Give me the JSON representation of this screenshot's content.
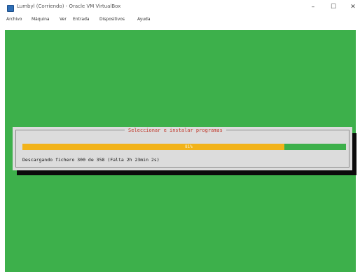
{
  "window": {
    "title": "Lumbyl (Corriendo) - Oracle VM VirtualBox",
    "controls": {
      "minimize": "–",
      "maximize": "☐",
      "close": "✕"
    },
    "icon": "virtualbox-icon"
  },
  "menubar": {
    "items": [
      {
        "label": "Archivo"
      },
      {
        "label": "Máquina"
      },
      {
        "label": "Ver"
      },
      {
        "label": "Entrada"
      },
      {
        "label": "Dispositivos"
      },
      {
        "label": "Ayuda"
      }
    ]
  },
  "installer": {
    "dialog_title": "Seleccionar e instalar programas",
    "progress_percent": 81,
    "progress_label": "81%",
    "status_text": "Descargando fichero 300 de 358 (Falta 2h 23min 2s)",
    "colors": {
      "background": "#3db04b",
      "progress": "#f2b31a",
      "dialog": "#dcdcdc",
      "title": "#c0392b"
    }
  }
}
